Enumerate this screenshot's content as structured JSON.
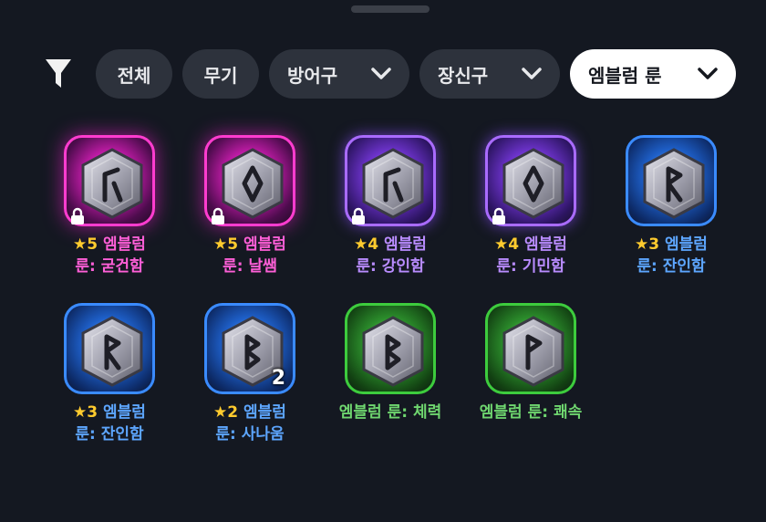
{
  "filter": {
    "icon": "funnel-icon",
    "tabs": [
      {
        "label": "전체",
        "dropdown": false,
        "active": false
      },
      {
        "label": "무기",
        "dropdown": false,
        "active": false
      },
      {
        "label": "방어구",
        "dropdown": true,
        "active": false
      },
      {
        "label": "장신구",
        "dropdown": true,
        "active": false
      },
      {
        "label": "엠블럼 룬",
        "dropdown": true,
        "active": true
      }
    ]
  },
  "items": [
    {
      "stars": "★5",
      "name_line1": "엠블럼",
      "name_line2": "룬: 굳건함",
      "rarity": "legendary",
      "rune": "gyeon",
      "locked": true,
      "count": ""
    },
    {
      "stars": "★5",
      "name_line1": "엠블럼",
      "name_line2": "룬: 날쌤",
      "rarity": "legendary",
      "rune": "diamond",
      "locked": true,
      "count": ""
    },
    {
      "stars": "★4",
      "name_line1": "엠블럼",
      "name_line2": "룬: 강인함",
      "rarity": "epic",
      "rune": "gyeon",
      "locked": true,
      "count": ""
    },
    {
      "stars": "★4",
      "name_line1": "엠블럼",
      "name_line2": "룬: 기민함",
      "rarity": "epic",
      "rune": "diamond",
      "locked": true,
      "count": ""
    },
    {
      "stars": "★3",
      "name_line1": "엠블럼",
      "name_line2": "룬: 잔인함",
      "rarity": "rare",
      "rune": "r",
      "locked": false,
      "count": ""
    },
    {
      "stars": "★3",
      "name_line1": "엠블럼",
      "name_line2": "룬: 잔인함",
      "rarity": "rare",
      "rune": "r",
      "locked": false,
      "count": ""
    },
    {
      "stars": "★2",
      "name_line1": "엠블럼",
      "name_line2": "룬: 사나움",
      "rarity": "rare",
      "rune": "b",
      "locked": false,
      "count": "2"
    },
    {
      "stars": "",
      "name_line1": "엠블럼 룬: 체력",
      "name_line2": "",
      "rarity": "uncommon",
      "rune": "b",
      "locked": false,
      "count": ""
    },
    {
      "stars": "",
      "name_line1": "엠블럼 룬: 쾌속",
      "name_line2": "",
      "rarity": "uncommon",
      "rune": "p",
      "locked": false,
      "count": ""
    }
  ]
}
